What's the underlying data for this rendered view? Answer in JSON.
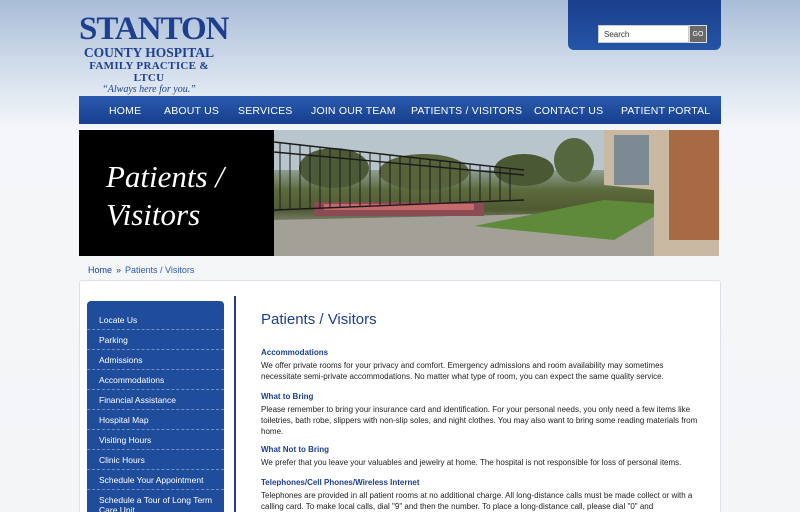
{
  "logo": {
    "line1": "STANTON",
    "line2": "COUNTY HOSPITAL",
    "line3": "FAMILY PRACTICE & LTCU",
    "tagline": "“Always here for you.”"
  },
  "search": {
    "placeholder": "Search",
    "value": "Search",
    "button_label": "GO"
  },
  "nav": {
    "items": [
      {
        "label": "HOME"
      },
      {
        "label": "ABOUT US"
      },
      {
        "label": "SERVICES"
      },
      {
        "label": "JOIN OUR TEAM"
      },
      {
        "label": "PATIENTS / VISITORS"
      },
      {
        "label": "CONTACT US"
      },
      {
        "label": "PATIENT PORTAL"
      }
    ]
  },
  "banner": {
    "title_line1": "Patients /",
    "title_line2": "Visitors"
  },
  "breadcrumb": {
    "home": "Home",
    "separator": "»",
    "current": "Patients / Visitors"
  },
  "sidebar": {
    "items": [
      {
        "label": "Locate Us"
      },
      {
        "label": "Parking"
      },
      {
        "label": "Admissions"
      },
      {
        "label": "Accommodations"
      },
      {
        "label": "Financial Assistance"
      },
      {
        "label": "Hospital Map"
      },
      {
        "label": "Visiting Hours"
      },
      {
        "label": "Clinic Hours"
      },
      {
        "label": "Schedule Your Appointment"
      },
      {
        "label": "Schedule a Tour of Long Term Care Unit"
      }
    ]
  },
  "main": {
    "title": "Patients / Visitors",
    "sections": [
      {
        "heading": "Accommodations",
        "body": "We offer private rooms for your privacy and comfort.  Emergency admissions and room availability may sometimes necessitate semi-private accommodations.  No matter what type of room, you can expect the same quality service."
      },
      {
        "heading": "What to Bring",
        "body": "Please remember to bring your insurance card and identification. For your personal needs, you only need a few items like toiletries, bath robe, slippers with non-slip soles, and night clothes. You may also want to bring some reading materials from home."
      },
      {
        "heading": "What Not to Bring",
        "body": "We prefer that you leave your valuables and jewelry at home. The hospital is not responsible for loss of personal items."
      },
      {
        "heading": "Telephones/Cell Phones/Wireless Internet",
        "body": "Telephones are provided in all patient rooms at no additional charge.  All long-distance calls must be made collect or with a calling card.  To make local calls, dial \"9\" and then the number.  To place a long-distance call, please dial \"0\" and"
      }
    ]
  },
  "colors": {
    "brand_blue": "#1c3f8f",
    "nav_blue": "#1f4d9c",
    "banner_black": "#000000"
  }
}
